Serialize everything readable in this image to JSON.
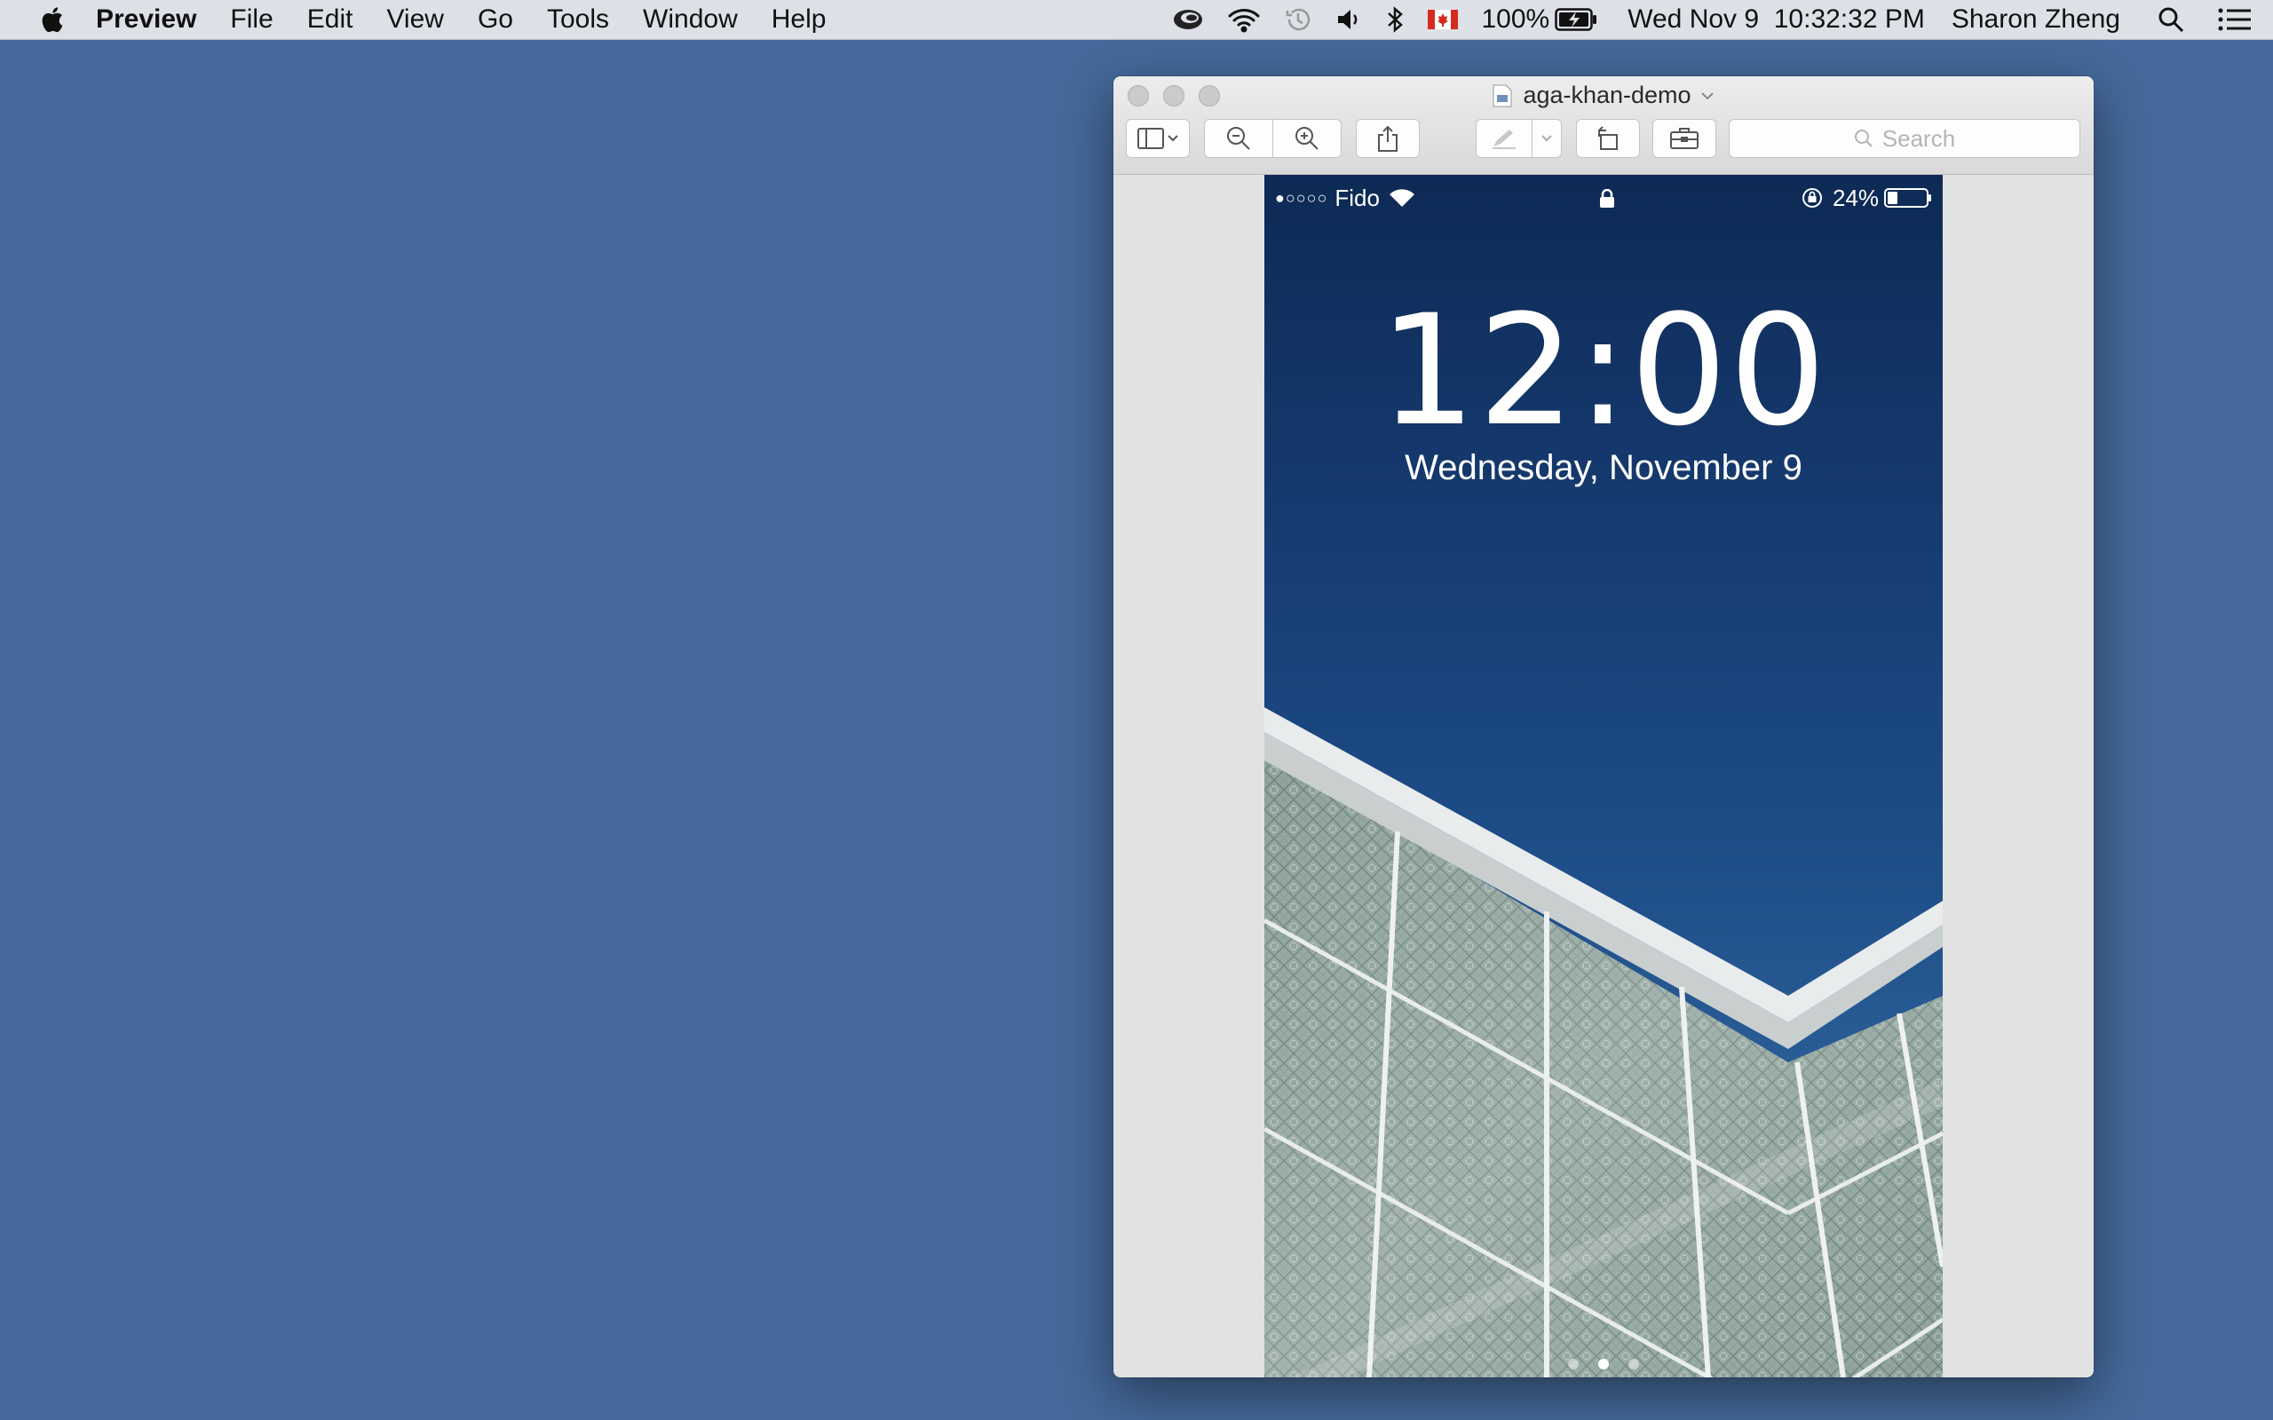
{
  "menubar": {
    "app": "Preview",
    "items": [
      "File",
      "Edit",
      "View",
      "Go",
      "Tools",
      "Window",
      "Help"
    ],
    "status": {
      "battery": "100%",
      "datetime": "Wed Nov 9  10:32:32 PM",
      "user": "Sharon Zheng"
    }
  },
  "window": {
    "title": "aga-khan-demo",
    "search_placeholder": "Search"
  },
  "phone": {
    "signal_dots": "●○○○○",
    "carrier": "Fido",
    "battery_percent": "24%",
    "time": "12:00",
    "date": "Wednesday, November 9"
  }
}
